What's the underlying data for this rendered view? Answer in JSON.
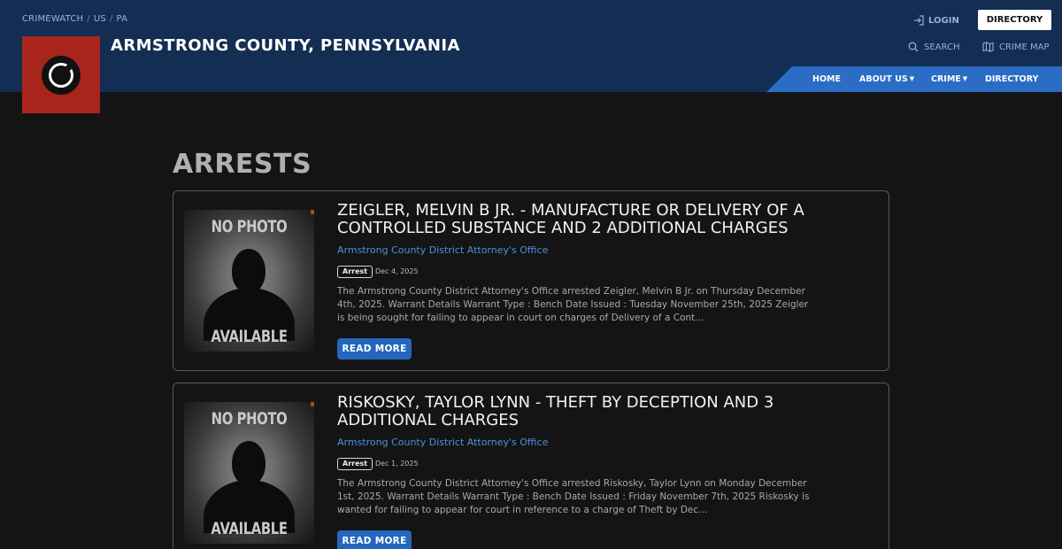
{
  "header": {
    "breadcrumbs": [
      "CRIMEWATCH",
      "US",
      "PA"
    ],
    "site_title": "ARMSTRONG COUNTY, PENNSYLVANIA",
    "login_label": "LOGIN",
    "directory_button": "DIRECTORY",
    "search_label": "SEARCH",
    "crime_map_label": "CRIME MAP",
    "nav": {
      "home": "HOME",
      "about": "ABOUT US",
      "crime": "CRIME",
      "directory": "DIRECTORY"
    },
    "colors": {
      "header_bg": "#132d53",
      "nav_bg": "#2b6cc4",
      "logo_bg": "#a7251d"
    }
  },
  "main": {
    "heading": "ARRESTS",
    "cards": [
      {
        "photo_top": "NO PHOTO",
        "photo_bottom": "AVAILABLE",
        "title": "ZEIGLER, MELVIN B JR. - MANUFACTURE OR DELIVERY OF A CONTROLLED SUBSTANCE AND 2 ADDITIONAL CHARGES",
        "agency": "Armstrong County District Attorney's Office",
        "badge": "Arrest",
        "date": "Dec 4, 2025",
        "excerpt": "The Armstrong County District Attorney's Office arrested Zeigler, Melvin B Jr. on Thursday December 4th, 2025. Warrant Details Warrant Type : Bench Date Issued : Tuesday November 25th, 2025 Zeigler is being sought for failing to appear in court on charges of Delivery of a Cont...",
        "read_more": "READ MORE"
      },
      {
        "photo_top": "NO PHOTO",
        "photo_bottom": "AVAILABLE",
        "title": "RISKOSKY, TAYLOR LYNN - THEFT BY DECEPTION AND 3 ADDITIONAL CHARGES",
        "agency": "Armstrong County District Attorney's Office",
        "badge": "Arrest",
        "date": "Dec 1, 2025",
        "excerpt": "The Armstrong County District Attorney's Office arrested Riskosky, Taylor Lynn on Monday December 1st, 2025. Warrant Details Warrant Type : Bench Date Issued : Friday November 7th, 2025 Riskosky is wanted for failing to appear for court in reference to a charge of Theft by Dec...",
        "read_more": "READ MORE"
      }
    ]
  }
}
